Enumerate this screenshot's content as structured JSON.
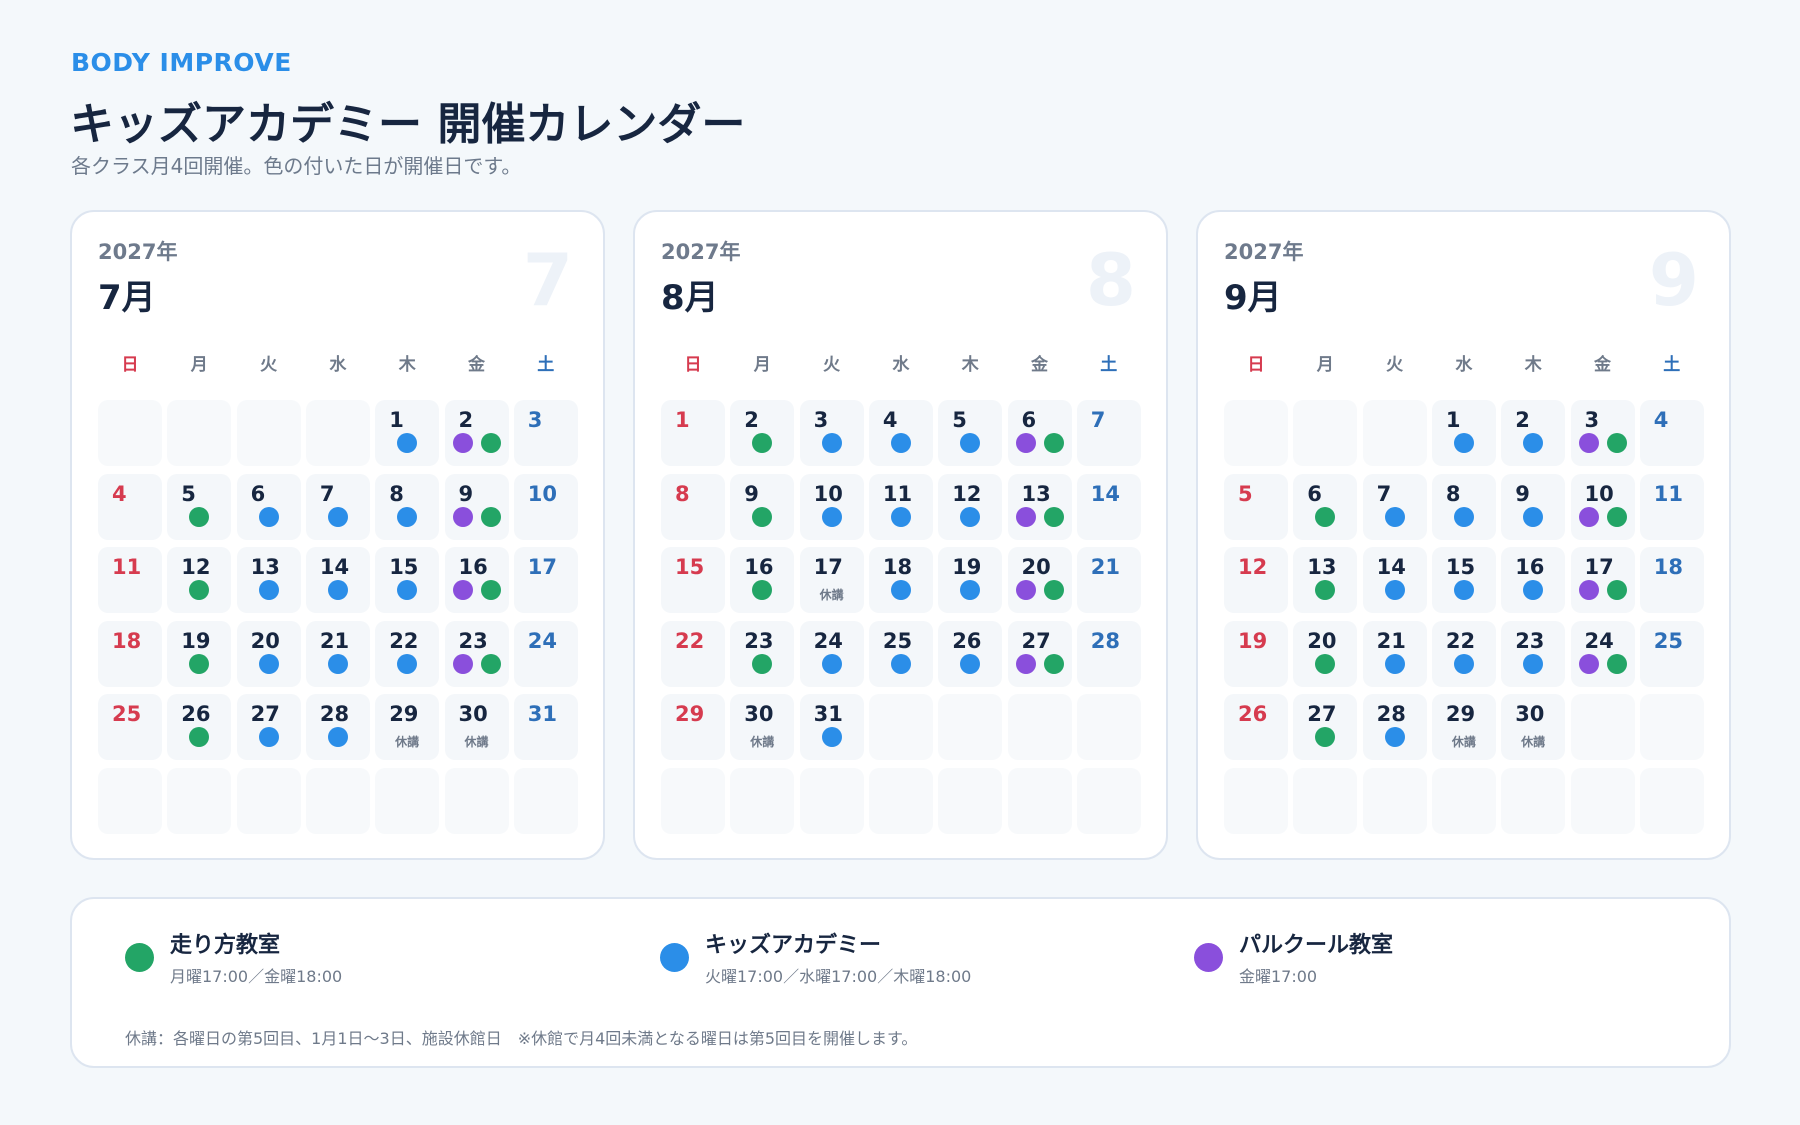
{
  "header": {
    "brand": "BODY IMPROVE",
    "title": "キッズアカデミー 開催カレンダー",
    "subtitle": "各クラス月4回開催。色の付いた日が開催日です。"
  },
  "colors": {
    "running": "#23a566",
    "kids": "#2b8ee8",
    "parkour": "#8a4fdc"
  },
  "weekdays": [
    "日",
    "月",
    "火",
    "水",
    "木",
    "金",
    "土"
  ],
  "months": [
    {
      "year": "2027年",
      "month": "7月",
      "big": "7",
      "first_weekday": 4,
      "days": 31,
      "events": {
        "1": [
          "kids"
        ],
        "2": [
          "parkour",
          "running"
        ],
        "5": [
          "running"
        ],
        "6": [
          "kids"
        ],
        "7": [
          "kids"
        ],
        "8": [
          "kids"
        ],
        "9": [
          "parkour",
          "running"
        ],
        "12": [
          "running"
        ],
        "13": [
          "kids"
        ],
        "14": [
          "kids"
        ],
        "15": [
          "kids"
        ],
        "16": [
          "parkour",
          "running"
        ],
        "19": [
          "running"
        ],
        "20": [
          "kids"
        ],
        "21": [
          "kids"
        ],
        "22": [
          "kids"
        ],
        "23": [
          "parkour",
          "running"
        ],
        "26": [
          "running"
        ],
        "27": [
          "kids"
        ],
        "28": [
          "kids"
        ]
      },
      "notes": {
        "29": "休講",
        "30": "休講"
      }
    },
    {
      "year": "2027年",
      "month": "8月",
      "big": "8",
      "first_weekday": 0,
      "days": 31,
      "events": {
        "2": [
          "running"
        ],
        "3": [
          "kids"
        ],
        "4": [
          "kids"
        ],
        "5": [
          "kids"
        ],
        "6": [
          "parkour",
          "running"
        ],
        "9": [
          "running"
        ],
        "10": [
          "kids"
        ],
        "11": [
          "kids"
        ],
        "12": [
          "kids"
        ],
        "13": [
          "parkour",
          "running"
        ],
        "16": [
          "running"
        ],
        "18": [
          "kids"
        ],
        "19": [
          "kids"
        ],
        "20": [
          "parkour",
          "running"
        ],
        "23": [
          "running"
        ],
        "24": [
          "kids"
        ],
        "25": [
          "kids"
        ],
        "26": [
          "kids"
        ],
        "27": [
          "parkour",
          "running"
        ],
        "31": [
          "kids"
        ]
      },
      "notes": {
        "17": "休講",
        "30": "休講"
      }
    },
    {
      "year": "2027年",
      "month": "9月",
      "big": "9",
      "first_weekday": 3,
      "days": 30,
      "events": {
        "1": [
          "kids"
        ],
        "2": [
          "kids"
        ],
        "3": [
          "parkour",
          "running"
        ],
        "6": [
          "running"
        ],
        "7": [
          "kids"
        ],
        "8": [
          "kids"
        ],
        "9": [
          "kids"
        ],
        "10": [
          "parkour",
          "running"
        ],
        "13": [
          "running"
        ],
        "14": [
          "kids"
        ],
        "15": [
          "kids"
        ],
        "16": [
          "kids"
        ],
        "17": [
          "parkour",
          "running"
        ],
        "20": [
          "running"
        ],
        "21": [
          "kids"
        ],
        "22": [
          "kids"
        ],
        "23": [
          "kids"
        ],
        "24": [
          "parkour",
          "running"
        ],
        "27": [
          "running"
        ],
        "28": [
          "kids"
        ]
      },
      "notes": {
        "29": "休講",
        "30": "休講"
      }
    }
  ],
  "legend": {
    "items": [
      {
        "key": "running",
        "name": "走り方教室",
        "time": "月曜17:00／金曜18:00"
      },
      {
        "key": "kids",
        "name": "キッズアカデミー",
        "time": "火曜17:00／水曜17:00／木曜18:00"
      },
      {
        "key": "parkour",
        "name": "パルクール教室",
        "time": "金曜17:00"
      }
    ],
    "note": "休講：各曜日の第5回目、1月1日〜3日、施設休館日　※休館で月4回未満となる曜日は第5回目を開催します。"
  }
}
